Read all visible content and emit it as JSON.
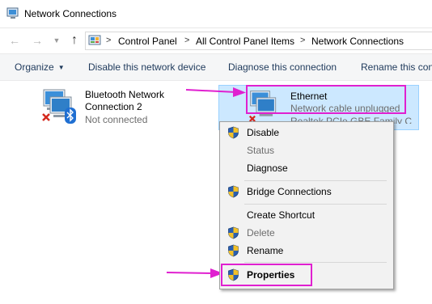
{
  "window": {
    "title": "Network Connections"
  },
  "address": {
    "crumbs": [
      "Control Panel",
      "All Control Panel Items",
      "Network Connections"
    ]
  },
  "commands": {
    "organize": "Organize",
    "disable": "Disable this network device",
    "diagnose": "Diagnose this connection",
    "rename": "Rename this con"
  },
  "connections": [
    {
      "name_line1": "Bluetooth Network",
      "name_line2": "Connection 2",
      "status": "Not connected",
      "icon": "bluetooth-network-adapter-icon"
    },
    {
      "name": "Ethernet",
      "status": "Network cable unplugged",
      "device": "Realtek PCIe GBE Family C",
      "icon": "ethernet-adapter-icon"
    }
  ],
  "context_menu": {
    "items": [
      {
        "label": "Disable",
        "shield": true,
        "disabled": false
      },
      {
        "label": "Status",
        "shield": false,
        "disabled": true
      },
      {
        "label": "Diagnose",
        "shield": false,
        "disabled": false
      },
      {
        "label": "Bridge Connections",
        "shield": true,
        "disabled": false
      },
      {
        "label": "Create Shortcut",
        "shield": false,
        "disabled": false
      },
      {
        "label": "Delete",
        "shield": true,
        "disabled": true
      },
      {
        "label": "Rename",
        "shield": true,
        "disabled": false
      },
      {
        "label": "Properties",
        "shield": true,
        "disabled": false,
        "bold": true
      }
    ]
  },
  "colors": {
    "annotation": "#e020d0",
    "selection_bg": "#cce8ff",
    "command_text": "#1e395b"
  }
}
